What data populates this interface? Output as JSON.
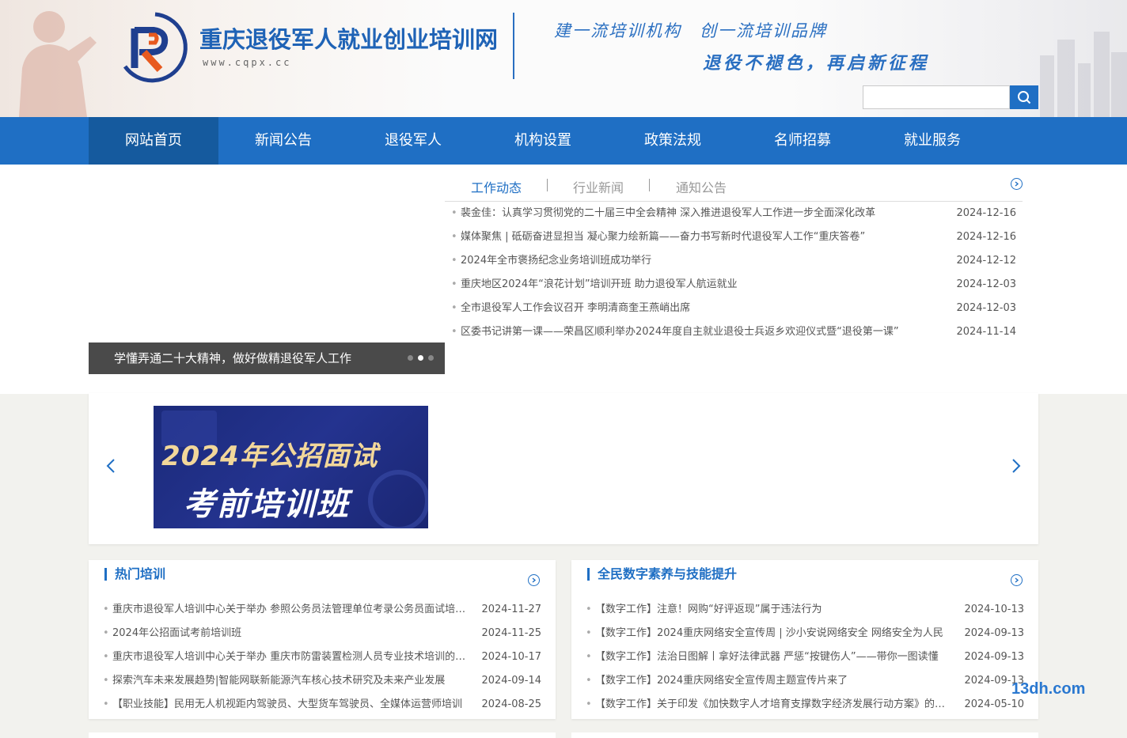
{
  "header": {
    "title": "重庆退役军人就业创业培训网",
    "url": "www.cqpx.cc",
    "slogan1": "建一流培训机构　创一流培训品牌",
    "slogan2": "退役不褪色，再启新征程",
    "search_placeholder": ""
  },
  "nav": {
    "items": [
      {
        "label": "网站首页"
      },
      {
        "label": "新闻公告"
      },
      {
        "label": "退役军人"
      },
      {
        "label": "机构设置"
      },
      {
        "label": "政策法规"
      },
      {
        "label": "名师招募"
      },
      {
        "label": "就业服务"
      }
    ]
  },
  "slider": {
    "caption": "学懂弄通二十大精神，做好做精退役军人工作"
  },
  "tabs": [
    {
      "label": "工作动态"
    },
    {
      "label": "行业新闻"
    },
    {
      "label": "通知公告"
    }
  ],
  "news": [
    {
      "title": "裴金佳：认真学习贯彻党的二十届三中全会精神 深入推进退役军人工作进一步全面深化改革",
      "date": "2024-12-16"
    },
    {
      "title": "媒体聚焦 | 砥砺奋进显担当 凝心聚力绘新篇——奋力书写新时代退役军人工作“重庆答卷”",
      "date": "2024-12-16"
    },
    {
      "title": "2024年全市褒扬纪念业务培训班成功举行",
      "date": "2024-12-12"
    },
    {
      "title": "重庆地区2024年“浪花计划”培训开班 助力退役军人航运就业",
      "date": "2024-12-03"
    },
    {
      "title": "全市退役军人工作会议召开 李明清商奎王燕峭出席",
      "date": "2024-12-03"
    },
    {
      "title": "区委书记讲第一课——荣昌区顺利举办2024年度自主就业退役士兵返乡欢迎仪式暨“退役第一课”",
      "date": "2024-11-14"
    }
  ],
  "banner": {
    "line1": "2024年公招面试",
    "line2": "考前培训班"
  },
  "hot_training": {
    "title": "热门培训",
    "items": [
      {
        "title": "重庆市退役军人培训中心关于举办 参照公务员法管理单位考录公务员面试培训班的通知",
        "date": "2024-11-27"
      },
      {
        "title": "2024年公招面试考前培训班",
        "date": "2024-11-25"
      },
      {
        "title": "重庆市退役军人培训中心关于举办 重庆市防雷装置检测人员专业技术培训的通知",
        "date": "2024-10-17"
      },
      {
        "title": "探索汽车未来发展趋势|智能网联新能源汽车核心技术研究及未来产业发展",
        "date": "2024-09-14"
      },
      {
        "title": "【职业技能】民用无人机视距内驾驶员、大型货车驾驶员、全媒体运营师培训",
        "date": "2024-08-25"
      }
    ]
  },
  "digital": {
    "title": "全民数字素养与技能提升",
    "items": [
      {
        "title": "【数字工作】注意！网购“好评返现”属于违法行为",
        "date": "2024-10-13"
      },
      {
        "title": "【数字工作】2024重庆网络安全宣传周 | 沙小安说网络安全 网络安全为人民",
        "date": "2024-09-13"
      },
      {
        "title": "【数字工作】法治日图解丨拿好法律武器 严惩“按键伤人”——带你一图读懂",
        "date": "2024-09-13"
      },
      {
        "title": "【数字工作】2024重庆网络安全宣传周主题宣传片来了",
        "date": "2024-09-13"
      },
      {
        "title": "【数字工作】关于印发《加快数字人才培育支撑数字经济发展行动方案》的通知",
        "date": "2024-05-10"
      }
    ]
  },
  "watermark": "13dh.com",
  "colors": {
    "primary": "#1f6fc4",
    "nav_active": "#155a9e"
  }
}
